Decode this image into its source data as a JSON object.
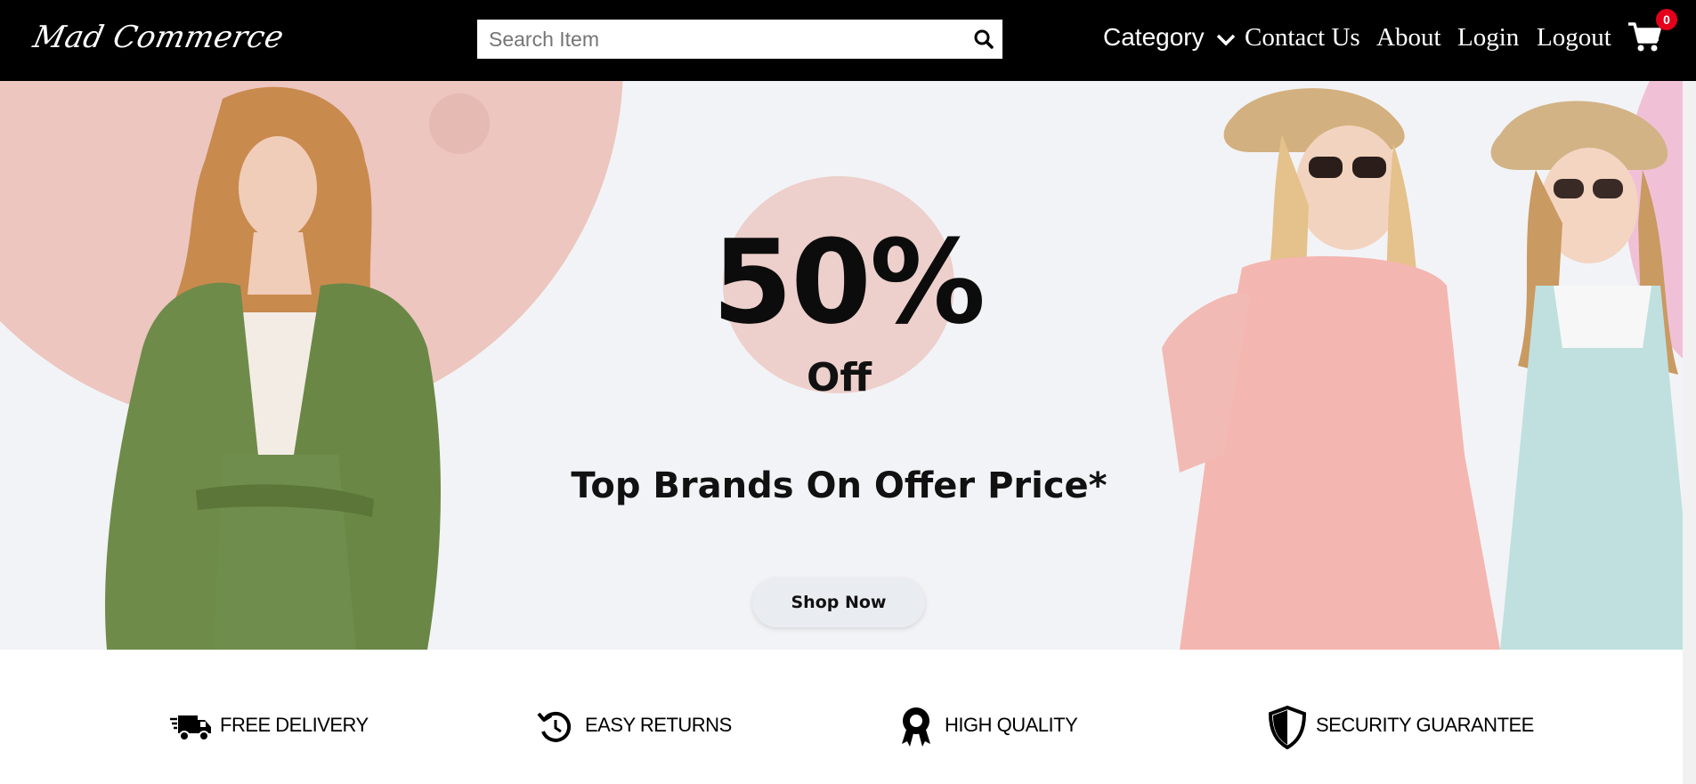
{
  "header": {
    "logo": "Mad Commerce",
    "search_placeholder": "Search Item",
    "nav": {
      "category": "Category",
      "contact": "Contact Us",
      "about": "About",
      "login": "Login",
      "logout": "Logout"
    },
    "cart_count": "0"
  },
  "hero": {
    "discount": "50%",
    "off": "Off",
    "tagline": "Top Brands On Offer Price*",
    "cta": "Shop Now"
  },
  "features": [
    {
      "label": "Free Delivery",
      "icon": "truck-icon"
    },
    {
      "label": "Easy Returns",
      "icon": "return-icon"
    },
    {
      "label": "High Quality",
      "icon": "award-icon"
    },
    {
      "label": "Security Guarantee",
      "icon": "shield-icon"
    }
  ],
  "colors": {
    "header_bg": "#000000",
    "hero_bg": "#f2f3f6",
    "accent_pink": "#ecc6bf",
    "badge": "#e4001b"
  }
}
